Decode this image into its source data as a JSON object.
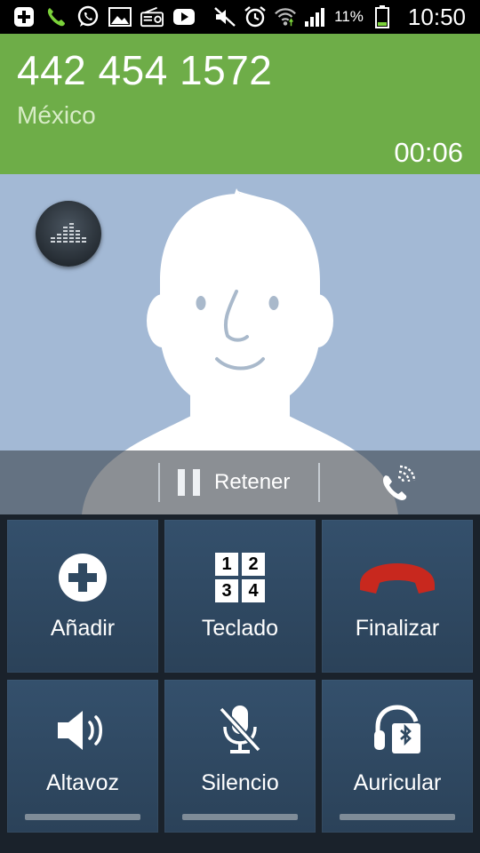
{
  "status_bar": {
    "battery_percent": "11%",
    "time": "10:50",
    "icons": [
      "add-icon",
      "phone-icon",
      "whatsapp-icon",
      "gallery-icon",
      "radio-icon",
      "youtube-icon",
      "mute-icon",
      "alarm-icon",
      "wifi-icon",
      "signal-icon",
      "battery-icon"
    ]
  },
  "call": {
    "number": "442 454 1572",
    "location": "México",
    "duration": "00:06"
  },
  "actions": {
    "hold_label": "Retener"
  },
  "grid": {
    "add_label": "Añadir",
    "keypad_label": "Teclado",
    "end_label": "Finalizar",
    "speaker_label": "Altavoz",
    "mute_label": "Silencio",
    "headset_label": "Auricular",
    "keypad_digits": [
      "1",
      "2",
      "3",
      "4"
    ]
  },
  "colors": {
    "header": "#6ead48",
    "photo_bg": "#a3b9d5",
    "tile": "#2f4961",
    "end_call": "#c8281e"
  }
}
